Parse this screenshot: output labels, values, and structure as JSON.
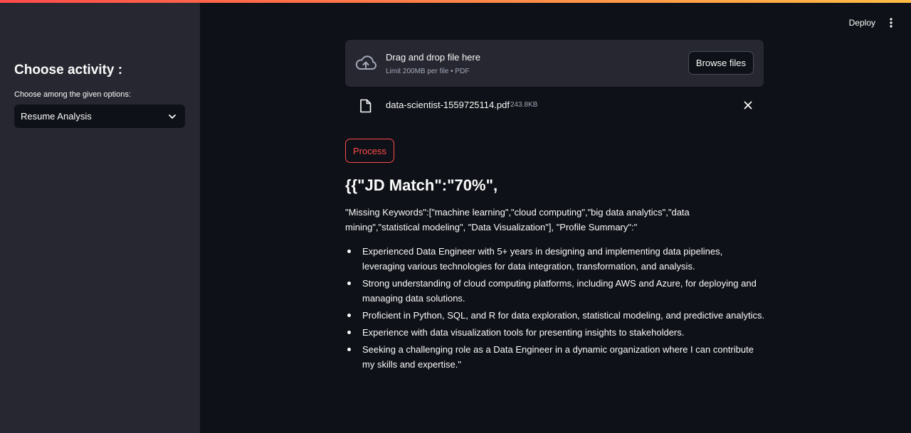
{
  "sidebar": {
    "heading": "Choose activity :",
    "select_label": "Choose among the given options:",
    "select_value": "Resume Analysis"
  },
  "header": {
    "deploy_label": "Deploy"
  },
  "uploader": {
    "title": "Drag and drop file here",
    "limit": "Limit 200MB per file • PDF",
    "browse_label": "Browse files"
  },
  "file": {
    "name": "data-scientist-1559725114.pdf",
    "size": "243.8KB"
  },
  "process_label": "Process",
  "result": {
    "heading": "{{\"JD Match\":\"70%\",",
    "keywords_text": "\"Missing Keywords\":[\"machine learning\",\"cloud computing\",\"big data analytics\",\"data mining\",\"statistical modeling\", \"Data Visualization\"], \"Profile Summary\":\"",
    "bullets": [
      "Experienced Data Engineer with 5+ years in designing and implementing data pipelines, leveraging various technologies for data integration, transformation, and analysis.",
      "Strong understanding of cloud computing platforms, including AWS and Azure, for deploying and managing data solutions.",
      "Proficient in Python, SQL, and R for data exploration, statistical modeling, and predictive analytics.",
      "Experience with data visualization tools for presenting insights to stakeholders.",
      "Seeking a challenging role as a Data Engineer in a dynamic organization where I can contribute my skills and expertise.\""
    ]
  },
  "icons": {
    "upload": "cloud-upload-icon",
    "file": "file-icon",
    "close": "close-icon",
    "menu": "kebab-menu-icon",
    "chevron": "chevron-down-icon"
  },
  "colors": {
    "accent": "#ff4b4b",
    "background": "#0e1117",
    "sidebar": "#262730",
    "secondary_text": "#a3a8b8"
  }
}
